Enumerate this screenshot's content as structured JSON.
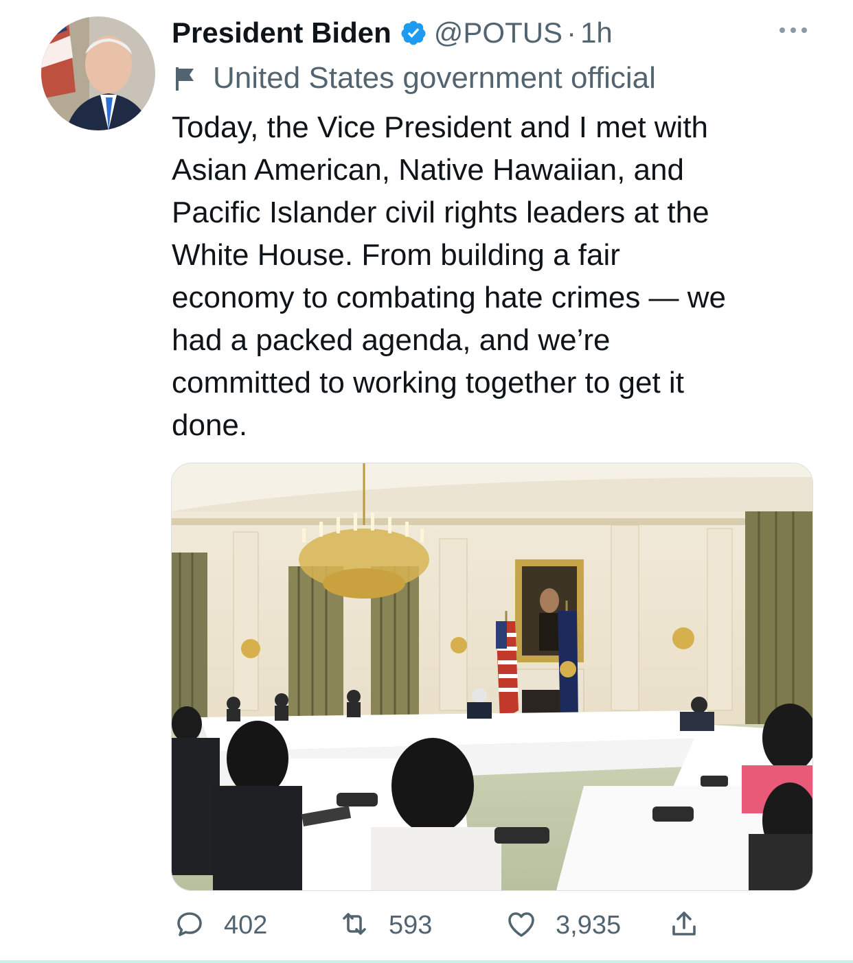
{
  "tweet": {
    "display_name": "President Biden",
    "handle": "@POTUS",
    "separator": "·",
    "time": "1h",
    "label": "United States government official",
    "text_lines": [
      "Today, the Vice President and I met with",
      "Asian American, Native Hawaiian, and",
      "Pacific Islander civil rights leaders at the",
      "White House. From building a fair",
      "economy to combating hate crimes — we",
      "had a packed agenda, and we’re",
      "committed to working together to get it",
      "done."
    ]
  },
  "actions": {
    "replies": "402",
    "retweets": "593",
    "likes": "3,935"
  },
  "icons": {
    "verified": "verified-badge-icon",
    "label": "flag-icon",
    "more": "more-options-icon",
    "reply": "reply-icon",
    "retweet": "retweet-icon",
    "like": "heart-icon",
    "share": "share-icon"
  },
  "colors": {
    "verified_blue": "#1d9bf0",
    "text_primary": "#0f1419",
    "text_secondary": "#536471"
  }
}
